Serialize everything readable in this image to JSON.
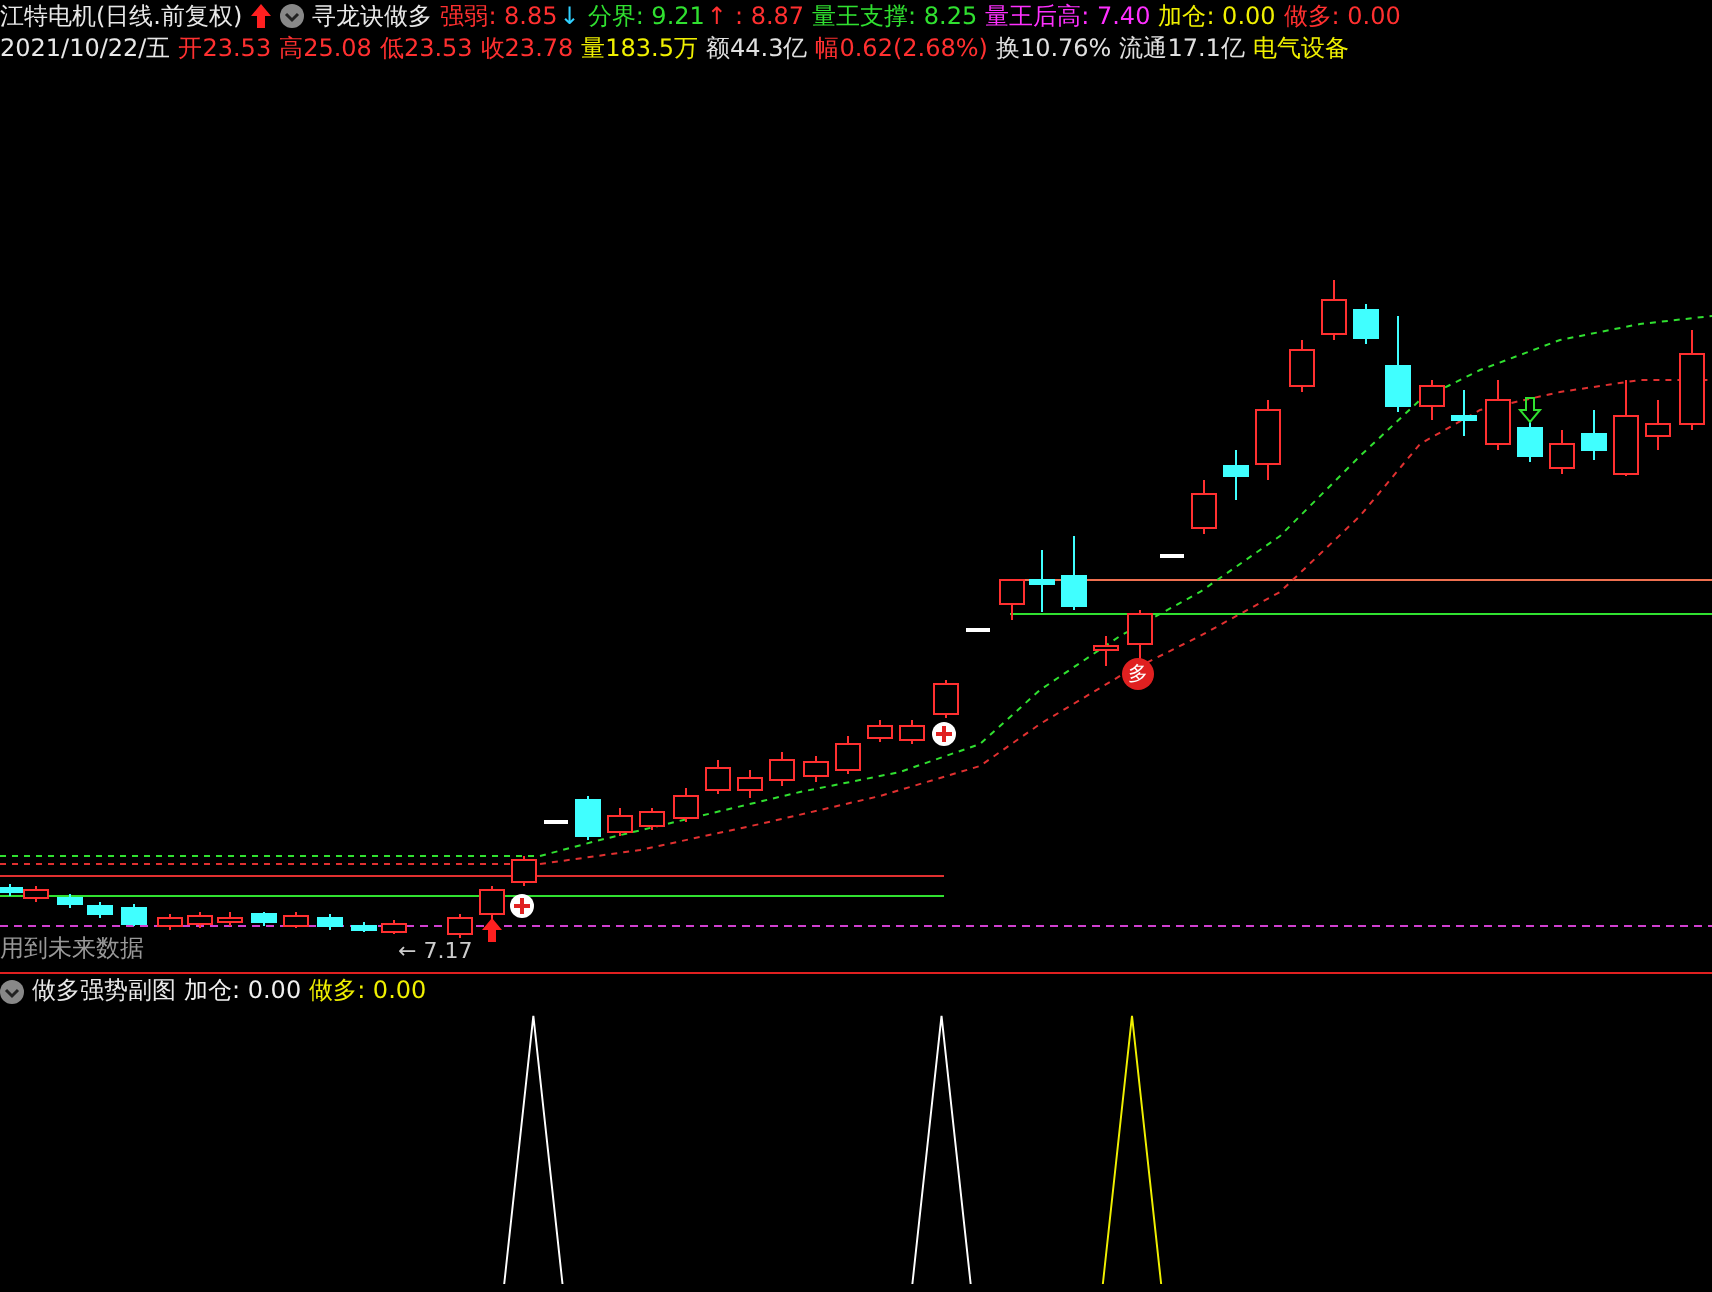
{
  "header": {
    "title": "江特电机(日线.前复权)",
    "indicator_name": "寻龙诀做多",
    "indicators": [
      {
        "kind": "value",
        "text": "强弱: 8.85",
        "color": "#ff3030"
      },
      {
        "kind": "arrow",
        "text": "↓",
        "color": "#30d0ff"
      },
      {
        "kind": "value",
        "text": "分界: 9.21",
        "color": "#30e030"
      },
      {
        "kind": "arrow",
        "text": "↑",
        "color": "#ff3030"
      },
      {
        "kind": "value",
        "text": ": 8.87",
        "color": "#ff3030"
      },
      {
        "kind": "value",
        "text": "量王支撑: 8.25",
        "color": "#30e030"
      },
      {
        "kind": "value",
        "text": "量王后高: 7.40",
        "color": "#ff30ff"
      },
      {
        "kind": "value",
        "text": "加仓: 0.00",
        "color": "#f0f000"
      },
      {
        "kind": "value",
        "text": "做多: 0.00",
        "color": "#ff3030"
      }
    ]
  },
  "quote": {
    "date": "2021/10/22/五",
    "fields": [
      {
        "text": "开23.53",
        "color": "#ff3030"
      },
      {
        "text": "高25.08",
        "color": "#ff3030"
      },
      {
        "text": "低23.53",
        "color": "#ff3030"
      },
      {
        "text": "收23.78",
        "color": "#ff3030"
      },
      {
        "text": "量183.5万",
        "color": "#f0f000"
      },
      {
        "text": "额44.3亿",
        "color": "#e0e0e0"
      },
      {
        "text": "幅0.62(2.68%)",
        "color": "#ff3030"
      },
      {
        "text": "换10.76%",
        "color": "#e0e0e0"
      },
      {
        "text": "流通17.1亿",
        "color": "#e0e0e0"
      },
      {
        "text": "电气设备",
        "color": "#f0f000"
      }
    ]
  },
  "chart": {
    "future_data_note": "用到未来数据",
    "low_marker": "← 7.17",
    "badge": "多"
  },
  "sub_panel": {
    "title": "做多强势副图",
    "values": [
      {
        "text": "加仓: 0.00",
        "color": "#f0f0f0"
      },
      {
        "text": "做多: 0.00",
        "color": "#f0f000"
      }
    ]
  }
}
